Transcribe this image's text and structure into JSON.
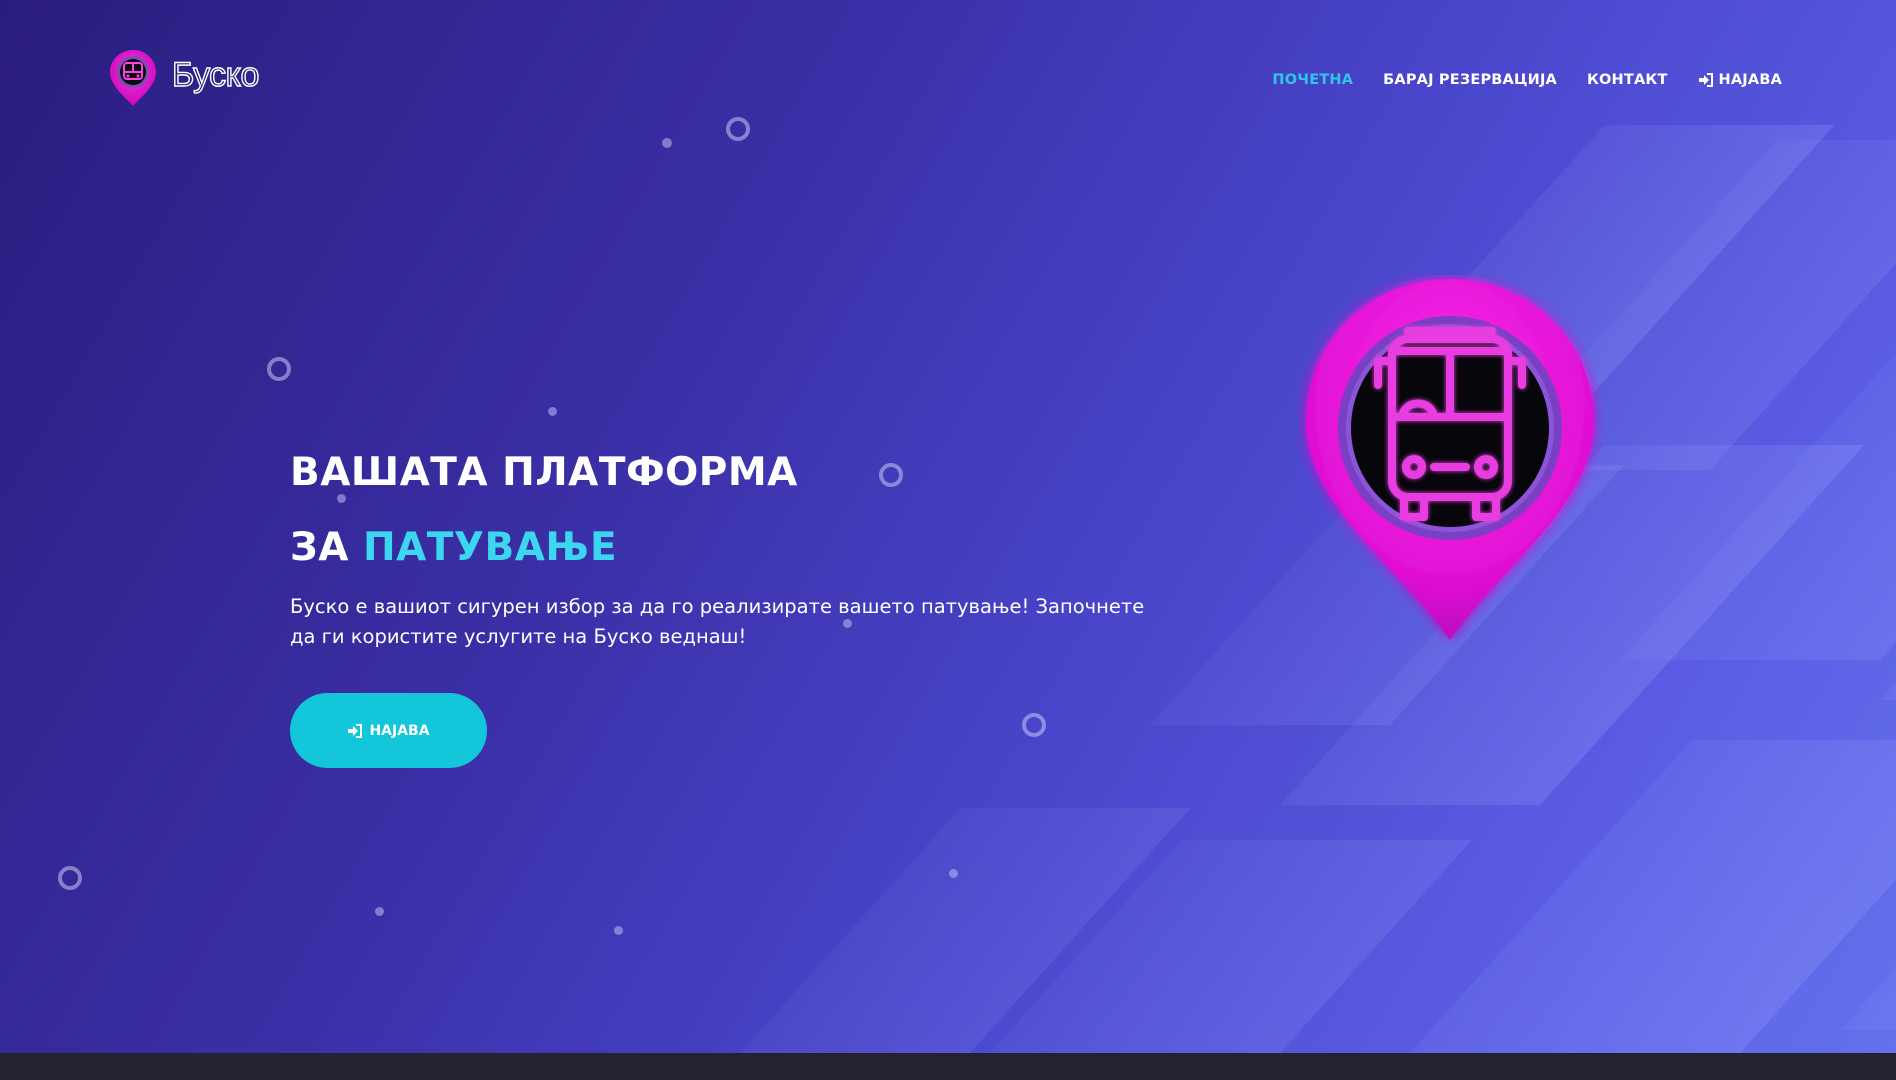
{
  "brand": {
    "name": "Буско",
    "logo_icon": "bus-pin-icon"
  },
  "nav": {
    "items": [
      {
        "label": "ПОЧЕТНА",
        "active": true
      },
      {
        "label": "БАРАЈ РЕЗЕРВАЦИЈА",
        "active": false
      },
      {
        "label": "КОНТАКТ",
        "active": false
      },
      {
        "label": "НАЈАВА",
        "active": false,
        "icon": "sign-in-icon"
      }
    ]
  },
  "hero": {
    "title_line1": "ВАШАТА ПЛАТФОРМА",
    "title_line2_prefix": "ЗА",
    "title_line2_accent": "ПАТУВАЊЕ",
    "description": "Буско е вашиот сигурен избор за да го реализирате вашето патување! Започнете да ги користите услугите на Буско веднаш!",
    "cta_label": "НАЈАВА",
    "cta_icon": "sign-in-icon",
    "illustration": "bus-location-pin-icon"
  },
  "colors": {
    "accent": "#2fc6ea",
    "button": "#13c6da",
    "pin": "#e610d0",
    "background_start": "#2a1d7e",
    "background_end": "#6470ec"
  }
}
